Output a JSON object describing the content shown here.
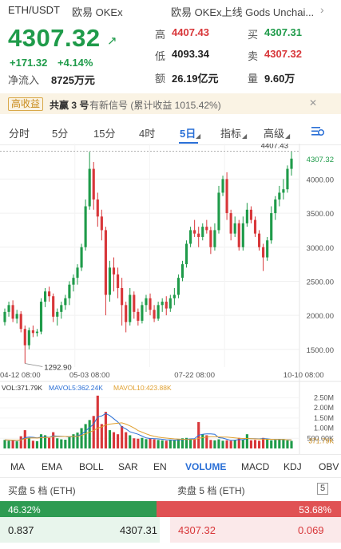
{
  "header": {
    "pair": "ETH/USDT",
    "exchange": "欧易 OKEx",
    "news": "欧易 OKEx上线 Gods Unchai...",
    "price": "4307.32",
    "change": "+171.32",
    "change_pct": "+4.14%",
    "inflow_label": "净流入",
    "inflow_value": "8725万元"
  },
  "stats": {
    "high_label": "高",
    "high": "4407.43",
    "low_label": "低",
    "low": "4093.34",
    "amount_label": "额",
    "amount": "26.19亿元",
    "buy_label": "买",
    "buy": "4307.31",
    "sell_label": "卖",
    "sell": "4307.32",
    "volume_label": "量",
    "volume": "9.60万"
  },
  "promo": {
    "badge": "高收益",
    "name": "共赢 3 号",
    "text": "有新信号 (累计收益 1015.42%)"
  },
  "timeframes": {
    "t1": "分时",
    "t2": "5分",
    "t3": "15分",
    "t4": "4时",
    "t5": "5日",
    "t6": "指标",
    "t7": "高级",
    "active": "5日"
  },
  "indicators": {
    "i1": "MA",
    "i2": "EMA",
    "i3": "BOLL",
    "i4": "SAR",
    "i5": "EN",
    "i6": "VOLUME",
    "i7": "MACD",
    "i8": "KDJ",
    "i9": "OBV",
    "active": "VOLUME"
  },
  "orderbook": {
    "buy_title": "买盘 5 档 (ETH)",
    "sell_title": "卖盘 5 档 (ETH)",
    "depth": "5",
    "buy_pct": "46.32%",
    "sell_pct": "53.68%",
    "buy_qty": "0.837",
    "buy_price": "4307.31",
    "sell_price": "4307.32",
    "sell_qty": "0.069"
  },
  "colors": {
    "up": "#1f9b4a",
    "down": "#d8373a",
    "accent": "#2a6fd6"
  },
  "chart_data": {
    "type": "candlestick",
    "y_ticks": [
      "4000.00",
      "3500.00",
      "3000.00",
      "2500.00",
      "2000.00",
      "1500.00"
    ],
    "y_values": [
      4000,
      3500,
      3000,
      2500,
      2000,
      1500
    ],
    "ylim": [
      1240,
      4520
    ],
    "x_labels": [
      "04-12 08:00",
      "05-03 08:00",
      "07-22 08:00",
      "10-10 08:00"
    ],
    "x_label_positions": [
      0,
      21,
      47,
      74
    ],
    "high_marker": "4407.43",
    "low_marker": "1292.90",
    "last_price_tag": "4307.32",
    "candles": [
      [
        1900,
        2050,
        1850,
        2100
      ],
      [
        2050,
        2150,
        1980,
        2200
      ],
      [
        2150,
        1950,
        1900,
        2220
      ],
      [
        1950,
        2020,
        1880,
        2080
      ],
      [
        2020,
        1800,
        1750,
        2060
      ],
      [
        1800,
        1560,
        1293,
        1850
      ],
      [
        1560,
        1780,
        1500,
        1820
      ],
      [
        1780,
        1740,
        1680,
        1850
      ],
      [
        1740,
        1760,
        1690,
        1800
      ],
      [
        1760,
        2200,
        1720,
        2250
      ],
      [
        2200,
        2350,
        2120,
        2400
      ],
      [
        2350,
        2280,
        2200,
        2420
      ],
      [
        2280,
        1980,
        1900,
        2320
      ],
      [
        1980,
        2050,
        1850,
        2100
      ],
      [
        2050,
        2150,
        1950,
        2200
      ],
      [
        2150,
        2250,
        2080,
        2300
      ],
      [
        2250,
        2450,
        2150,
        2500
      ],
      [
        2450,
        2550,
        2350,
        2600
      ],
      [
        2550,
        2700,
        2450,
        2750
      ],
      [
        2700,
        3000,
        2650,
        3050
      ],
      [
        3000,
        3600,
        2950,
        3700
      ],
      [
        3600,
        4150,
        3550,
        4400
      ],
      [
        4150,
        3700,
        3550,
        4250
      ],
      [
        3700,
        3450,
        3300,
        3800
      ],
      [
        3450,
        3250,
        3100,
        3550
      ],
      [
        3250,
        2300,
        2000,
        3300
      ],
      [
        2300,
        2700,
        2200,
        2800
      ],
      [
        2700,
        2600,
        2350,
        2850
      ],
      [
        2600,
        2400,
        2250,
        2700
      ],
      [
        2400,
        2150,
        1850,
        2550
      ],
      [
        2150,
        1900,
        1750,
        2200
      ],
      [
        1900,
        2300,
        1850,
        2400
      ],
      [
        2300,
        2050,
        1950,
        2350
      ],
      [
        2050,
        1920,
        1850,
        2100
      ],
      [
        1920,
        2150,
        1880,
        2200
      ],
      [
        2150,
        2250,
        2050,
        2300
      ],
      [
        2250,
        2080,
        2000,
        2320
      ],
      [
        2080,
        1950,
        1900,
        2150
      ],
      [
        1950,
        2150,
        1920,
        2200
      ],
      [
        2150,
        2200,
        2050,
        2250
      ],
      [
        2200,
        2100,
        2000,
        2280
      ],
      [
        2100,
        2250,
        2050,
        2300
      ],
      [
        2250,
        2300,
        2150,
        2400
      ],
      [
        2300,
        2550,
        2250,
        2600
      ],
      [
        2550,
        2750,
        2500,
        2800
      ],
      [
        2750,
        3050,
        2700,
        3100
      ],
      [
        3050,
        3250,
        3000,
        3300
      ],
      [
        3250,
        3200,
        3150,
        3400
      ],
      [
        3200,
        3150,
        3000,
        3300
      ],
      [
        3150,
        3300,
        3100,
        3350
      ],
      [
        3300,
        3250,
        3200,
        3400
      ],
      [
        3250,
        3000,
        2900,
        3300
      ],
      [
        3000,
        3250,
        2950,
        3350
      ],
      [
        3250,
        3800,
        3200,
        3900
      ],
      [
        3800,
        4000,
        3750,
        4050
      ],
      [
        4000,
        3500,
        3400,
        4100
      ],
      [
        3500,
        3200,
        3100,
        3550
      ],
      [
        3200,
        3350,
        3150,
        3450
      ],
      [
        3350,
        3000,
        2950,
        3400
      ],
      [
        3000,
        3350,
        2950,
        3450
      ],
      [
        3350,
        3550,
        3300,
        3650
      ],
      [
        3550,
        3400,
        3350,
        3600
      ],
      [
        3400,
        3200,
        3150,
        3450
      ],
      [
        3200,
        3000,
        2950,
        3250
      ],
      [
        3000,
        2850,
        2650,
        3050
      ],
      [
        2850,
        3100,
        2800,
        3150
      ],
      [
        3100,
        3500,
        3050,
        3600
      ],
      [
        3500,
        3700,
        3400,
        3750
      ],
      [
        3700,
        3800,
        3600,
        3900
      ],
      [
        3800,
        3850,
        3700,
        4000
      ],
      [
        3850,
        4150,
        3800,
        4200
      ],
      [
        4150,
        4300,
        4050,
        4407
      ]
    ],
    "volume": {
      "label": "VOL:371.79K",
      "mavol5_label": "MAVOL5:362.24K",
      "mavol10_label": "MAVOL10:423.88K",
      "y_ticks": [
        "2.50M",
        "2.00M",
        "1.50M",
        "1.00M",
        "500.00K"
      ],
      "y_values": [
        2500,
        2000,
        1500,
        1000,
        500
      ],
      "last_tag": "371.79K",
      "ylim": [
        0,
        2750
      ],
      "values": [
        420,
        380,
        400,
        350,
        600,
        900,
        500,
        380,
        360,
        700,
        650,
        520,
        800,
        500,
        450,
        430,
        600,
        700,
        780,
        1000,
        1200,
        1400,
        1600,
        2600,
        1200,
        1800,
        900,
        800,
        700,
        1100,
        800,
        650,
        500,
        480,
        520,
        460,
        500,
        450,
        420,
        400,
        380,
        420,
        400,
        450,
        500,
        520,
        480,
        460,
        1300,
        700,
        650,
        420,
        400,
        450,
        380,
        400,
        380,
        420,
        520,
        440,
        700,
        400,
        420,
        380,
        520,
        460,
        400,
        420,
        440,
        460,
        400,
        372
      ],
      "mavol5": [
        420,
        410,
        400,
        390,
        430,
        530,
        560,
        550,
        520,
        560,
        560,
        550,
        620,
        610,
        600,
        590,
        560,
        590,
        620,
        700,
        860,
        1030,
        1200,
        1560,
        1600,
        1720,
        1620,
        1460,
        1300,
        1060,
        960,
        820,
        760,
        700,
        610,
        520,
        490,
        480,
        470,
        450,
        430,
        420,
        410,
        420,
        430,
        450,
        470,
        480,
        650,
        700,
        720,
        720,
        700,
        530,
        510,
        450,
        400,
        410,
        440,
        430,
        490,
        480,
        480,
        470,
        490,
        470,
        450,
        440,
        450,
        440,
        430,
        418
      ],
      "mavol10": [
        420,
        415,
        410,
        400,
        420,
        480,
        510,
        520,
        510,
        530,
        540,
        545,
        580,
        590,
        590,
        590,
        580,
        590,
        600,
        640,
        720,
        800,
        880,
        1000,
        1060,
        1160,
        1200,
        1220,
        1240,
        1260,
        1200,
        1110,
        1010,
        880,
        800,
        720,
        650,
        600,
        560,
        530,
        510,
        490,
        470,
        460,
        450,
        440,
        440,
        440,
        500,
        530,
        560,
        580,
        580,
        570,
        560,
        560,
        540,
        520,
        500,
        490,
        490,
        480,
        470,
        460,
        460,
        450,
        450,
        445,
        440,
        440,
        430,
        424
      ]
    }
  }
}
